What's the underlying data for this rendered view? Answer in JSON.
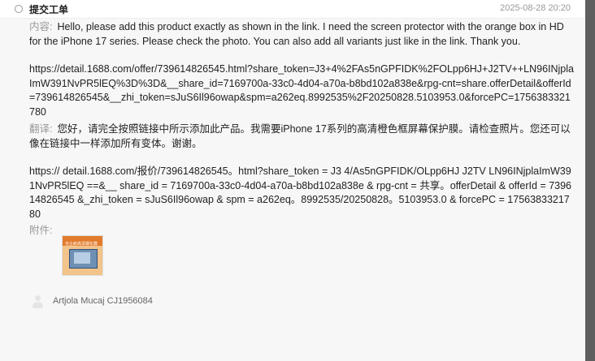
{
  "header": {
    "title": "提交工单",
    "timestamp": "2025-08-28 20:20"
  },
  "message": {
    "content_label": "内容:",
    "content_text": "Hello, please add this product exactly as shown in the link. I need the screen protector with the orange box in HD for the iPhone 17 series. Please check the photo. You can also add all variants just like in the link. Thank you.",
    "content_url": "https://detail.1688.com/offer/739614826545.html?share_token=J3+4%2FAs5nGPFIDK%2FOLpp6HJ+J2TV++LN96INjplaImW391NvPR5lEQ%3D%3D&__share_id=7169700a-33c0-4d04-a70a-b8bd102a838e&rpg-cnt=share.offerDetail&offerId=739614826545&__zhi_token=sJuS6Il96owap&spm=a262eq.8992535%2F20250828.5103953.0&forcePC=1756383321780",
    "translation_label": "翻译:",
    "translation_text": "您好，请完全按照链接中所示添加此产品。我需要iPhone 17系列的高清橙色框屏幕保护膜。请检查照片。您还可以像在链接中一样添加所有变体。谢谢。",
    "translation_url": "https:// detail.1688.com/报价/739614826545。html?share_token = J3 4/As5nGPFIDK/OLpp6HJ J2TV LN96INjplaImW391NvPR5lEQ ==&__ share_id = 7169700a-33c0-4d04-a70a-b8bd102a838e & rpg-cnt = 共享。offerDetail & offerId = 739614826545 &_zhi_token = sJuS6Il96owap & spm = a262eq。8992535/20250828。5103953.0 & forcePC = 1756383321780",
    "attachment_label": "附件:",
    "attachment_thumb_caption": "无尘舱高清钢化膜"
  },
  "footer": {
    "user": "Artjola Mucaj CJ1956084"
  },
  "colors": {
    "label_gray": "#999999",
    "thumb_orange": "#e27b2b"
  }
}
